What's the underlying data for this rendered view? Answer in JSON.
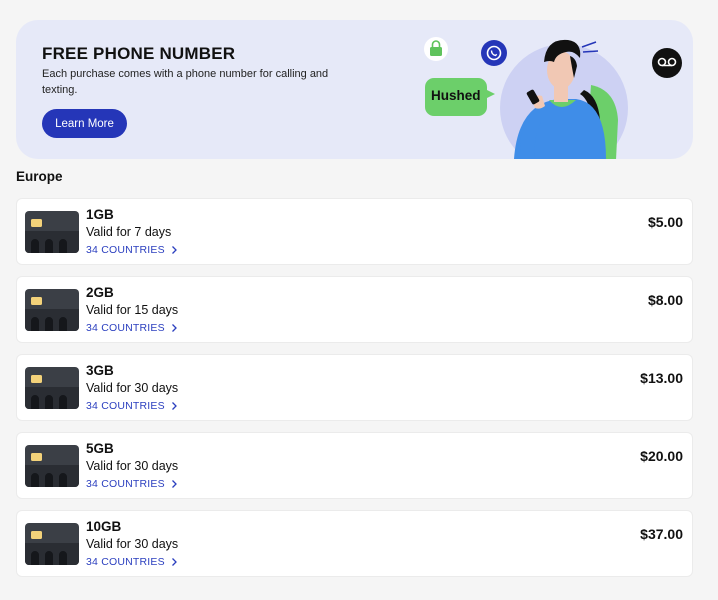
{
  "banner": {
    "title": "FREE PHONE NUMBER",
    "description": "Each purchase comes with a phone number for calling and texting.",
    "button_label": "Learn More",
    "bubble_text": "Hushed"
  },
  "section": {
    "title": "Europe"
  },
  "plans": [
    {
      "size": "1GB",
      "validity": "Valid for 7 days",
      "countries": "34 COUNTRIES",
      "price": "$5.00"
    },
    {
      "size": "2GB",
      "validity": "Valid for 15 days",
      "countries": "34 COUNTRIES",
      "price": "$8.00"
    },
    {
      "size": "3GB",
      "validity": "Valid for 30 days",
      "countries": "34 COUNTRIES",
      "price": "$13.00"
    },
    {
      "size": "5GB",
      "validity": "Valid for 30 days",
      "countries": "34 COUNTRIES",
      "price": "$20.00"
    },
    {
      "size": "10GB",
      "validity": "Valid for 30 days",
      "countries": "34 COUNTRIES",
      "price": "$37.00"
    }
  ],
  "colors": {
    "accent": "#2536b8",
    "link": "#2b3fbf",
    "banner_bg": "#e6e9f8",
    "bubble_green": "#6ccf6a",
    "shirt_blue": "#3f8de8"
  },
  "icons": [
    "lock-icon",
    "phone-call-icon",
    "voicemail-icon",
    "chevron-right-icon",
    "esim-card-icon"
  ]
}
